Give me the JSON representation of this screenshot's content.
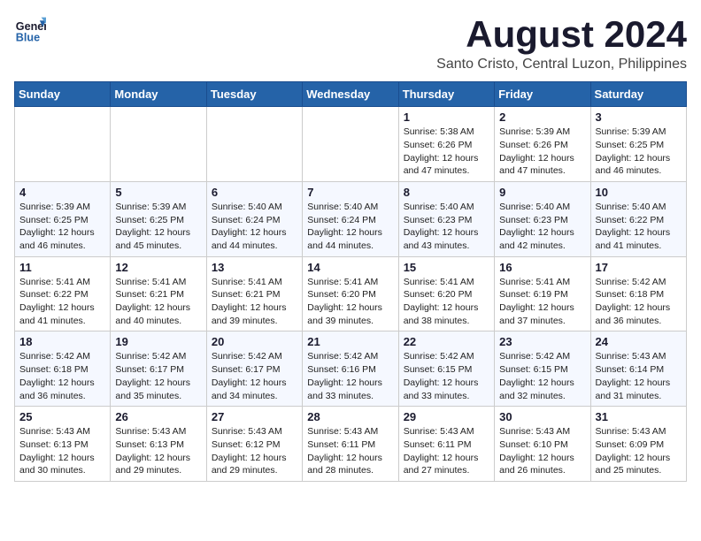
{
  "header": {
    "logo_line1": "General",
    "logo_line2": "Blue",
    "main_title": "August 2024",
    "subtitle": "Santo Cristo, Central Luzon, Philippines"
  },
  "calendar": {
    "weekdays": [
      "Sunday",
      "Monday",
      "Tuesday",
      "Wednesday",
      "Thursday",
      "Friday",
      "Saturday"
    ],
    "weeks": [
      [
        {
          "day": "",
          "info": ""
        },
        {
          "day": "",
          "info": ""
        },
        {
          "day": "",
          "info": ""
        },
        {
          "day": "",
          "info": ""
        },
        {
          "day": "1",
          "info": "Sunrise: 5:38 AM\nSunset: 6:26 PM\nDaylight: 12 hours\nand 47 minutes."
        },
        {
          "day": "2",
          "info": "Sunrise: 5:39 AM\nSunset: 6:26 PM\nDaylight: 12 hours\nand 47 minutes."
        },
        {
          "day": "3",
          "info": "Sunrise: 5:39 AM\nSunset: 6:25 PM\nDaylight: 12 hours\nand 46 minutes."
        }
      ],
      [
        {
          "day": "4",
          "info": "Sunrise: 5:39 AM\nSunset: 6:25 PM\nDaylight: 12 hours\nand 46 minutes."
        },
        {
          "day": "5",
          "info": "Sunrise: 5:39 AM\nSunset: 6:25 PM\nDaylight: 12 hours\nand 45 minutes."
        },
        {
          "day": "6",
          "info": "Sunrise: 5:40 AM\nSunset: 6:24 PM\nDaylight: 12 hours\nand 44 minutes."
        },
        {
          "day": "7",
          "info": "Sunrise: 5:40 AM\nSunset: 6:24 PM\nDaylight: 12 hours\nand 44 minutes."
        },
        {
          "day": "8",
          "info": "Sunrise: 5:40 AM\nSunset: 6:23 PM\nDaylight: 12 hours\nand 43 minutes."
        },
        {
          "day": "9",
          "info": "Sunrise: 5:40 AM\nSunset: 6:23 PM\nDaylight: 12 hours\nand 42 minutes."
        },
        {
          "day": "10",
          "info": "Sunrise: 5:40 AM\nSunset: 6:22 PM\nDaylight: 12 hours\nand 41 minutes."
        }
      ],
      [
        {
          "day": "11",
          "info": "Sunrise: 5:41 AM\nSunset: 6:22 PM\nDaylight: 12 hours\nand 41 minutes."
        },
        {
          "day": "12",
          "info": "Sunrise: 5:41 AM\nSunset: 6:21 PM\nDaylight: 12 hours\nand 40 minutes."
        },
        {
          "day": "13",
          "info": "Sunrise: 5:41 AM\nSunset: 6:21 PM\nDaylight: 12 hours\nand 39 minutes."
        },
        {
          "day": "14",
          "info": "Sunrise: 5:41 AM\nSunset: 6:20 PM\nDaylight: 12 hours\nand 39 minutes."
        },
        {
          "day": "15",
          "info": "Sunrise: 5:41 AM\nSunset: 6:20 PM\nDaylight: 12 hours\nand 38 minutes."
        },
        {
          "day": "16",
          "info": "Sunrise: 5:41 AM\nSunset: 6:19 PM\nDaylight: 12 hours\nand 37 minutes."
        },
        {
          "day": "17",
          "info": "Sunrise: 5:42 AM\nSunset: 6:18 PM\nDaylight: 12 hours\nand 36 minutes."
        }
      ],
      [
        {
          "day": "18",
          "info": "Sunrise: 5:42 AM\nSunset: 6:18 PM\nDaylight: 12 hours\nand 36 minutes."
        },
        {
          "day": "19",
          "info": "Sunrise: 5:42 AM\nSunset: 6:17 PM\nDaylight: 12 hours\nand 35 minutes."
        },
        {
          "day": "20",
          "info": "Sunrise: 5:42 AM\nSunset: 6:17 PM\nDaylight: 12 hours\nand 34 minutes."
        },
        {
          "day": "21",
          "info": "Sunrise: 5:42 AM\nSunset: 6:16 PM\nDaylight: 12 hours\nand 33 minutes."
        },
        {
          "day": "22",
          "info": "Sunrise: 5:42 AM\nSunset: 6:15 PM\nDaylight: 12 hours\nand 33 minutes."
        },
        {
          "day": "23",
          "info": "Sunrise: 5:42 AM\nSunset: 6:15 PM\nDaylight: 12 hours\nand 32 minutes."
        },
        {
          "day": "24",
          "info": "Sunrise: 5:43 AM\nSunset: 6:14 PM\nDaylight: 12 hours\nand 31 minutes."
        }
      ],
      [
        {
          "day": "25",
          "info": "Sunrise: 5:43 AM\nSunset: 6:13 PM\nDaylight: 12 hours\nand 30 minutes."
        },
        {
          "day": "26",
          "info": "Sunrise: 5:43 AM\nSunset: 6:13 PM\nDaylight: 12 hours\nand 29 minutes."
        },
        {
          "day": "27",
          "info": "Sunrise: 5:43 AM\nSunset: 6:12 PM\nDaylight: 12 hours\nand 29 minutes."
        },
        {
          "day": "28",
          "info": "Sunrise: 5:43 AM\nSunset: 6:11 PM\nDaylight: 12 hours\nand 28 minutes."
        },
        {
          "day": "29",
          "info": "Sunrise: 5:43 AM\nSunset: 6:11 PM\nDaylight: 12 hours\nand 27 minutes."
        },
        {
          "day": "30",
          "info": "Sunrise: 5:43 AM\nSunset: 6:10 PM\nDaylight: 12 hours\nand 26 minutes."
        },
        {
          "day": "31",
          "info": "Sunrise: 5:43 AM\nSunset: 6:09 PM\nDaylight: 12 hours\nand 25 minutes."
        }
      ]
    ]
  }
}
